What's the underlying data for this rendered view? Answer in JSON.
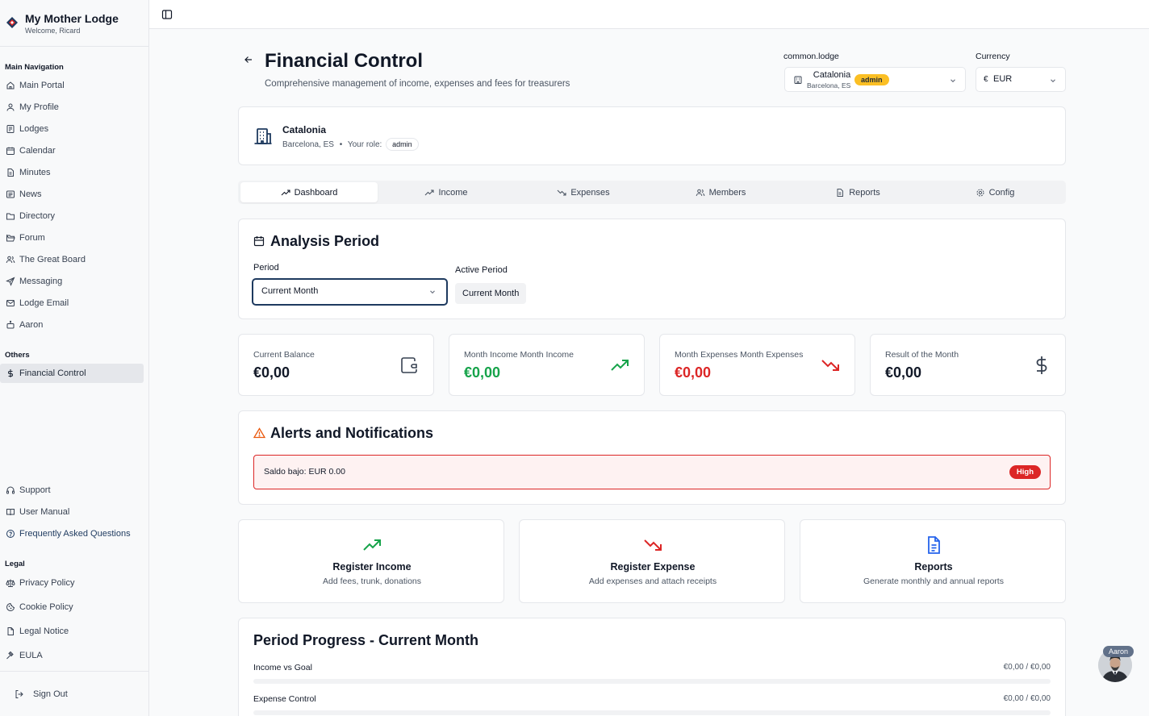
{
  "brand": {
    "title": "My Mother Lodge",
    "welcome": "Welcome, Ricard"
  },
  "sidebar": {
    "main_label": "Main Navigation",
    "main_items": [
      {
        "label": "Main Portal",
        "icon": "home-icon"
      },
      {
        "label": "My Profile",
        "icon": "user-icon"
      },
      {
        "label": "Lodges",
        "icon": "document-icon"
      },
      {
        "label": "Calendar",
        "icon": "calendar-icon"
      },
      {
        "label": "Minutes",
        "icon": "file-text-icon"
      },
      {
        "label": "News",
        "icon": "newspaper-icon"
      },
      {
        "label": "Directory",
        "icon": "folder-icon"
      },
      {
        "label": "Forum",
        "icon": "folder-open-icon"
      },
      {
        "label": "The Great Board",
        "icon": "users-icon"
      },
      {
        "label": "Messaging",
        "icon": "send-icon"
      },
      {
        "label": "Lodge Email",
        "icon": "mail-icon"
      },
      {
        "label": "Aaron",
        "icon": "bot-icon"
      }
    ],
    "others_label": "Others",
    "others_items": [
      {
        "label": "Financial Control",
        "icon": "dollar-icon",
        "active": true
      }
    ],
    "support_items": [
      {
        "label": "Support",
        "icon": "headphones-icon"
      },
      {
        "label": "User Manual",
        "icon": "book-icon"
      },
      {
        "label": "Frequently Asked Questions",
        "icon": "help-circle-icon"
      }
    ],
    "legal_label": "Legal",
    "legal_items": [
      {
        "label": "Privacy Policy",
        "icon": "scale-icon"
      },
      {
        "label": "Cookie Policy",
        "icon": "cookie-icon"
      },
      {
        "label": "Legal Notice",
        "icon": "file-icon"
      },
      {
        "label": "EULA",
        "icon": "gavel-icon"
      }
    ],
    "sign_out": "Sign Out"
  },
  "header": {
    "title": "Financial Control",
    "subtitle": "Comprehensive management of income, expenses and fees for treasurers",
    "lodge_label": "common.lodge",
    "lodge_name": "Catalonia",
    "lodge_location": "Barcelona, ES",
    "lodge_role": "admin",
    "currency_label": "Currency",
    "currency_symbol": "€",
    "currency_value": "EUR"
  },
  "lodge_card": {
    "name": "Catalonia",
    "location": "Barcelona, ES",
    "bullet": "•",
    "role_label": "Your role:",
    "role": "admin"
  },
  "tabs": [
    "Dashboard",
    "Income",
    "Expenses",
    "Members",
    "Reports",
    "Config"
  ],
  "period": {
    "title": "Analysis Period",
    "period_label": "Period",
    "period_value": "Current Month",
    "active_label": "Active Period",
    "active_value": "Current Month"
  },
  "stats": [
    {
      "label": "Current Balance",
      "value": "€0,00",
      "color": "#111827",
      "icon": "wallet-icon"
    },
    {
      "label": "Month Income Month Income",
      "value": "€0,00",
      "color": "#16a34a",
      "icon": "trending-up-icon"
    },
    {
      "label": "Month Expenses Month Expenses",
      "value": "€0,00",
      "color": "#dc2626",
      "icon": "trending-down-icon"
    },
    {
      "label": "Result of the Month",
      "value": "€0,00",
      "color": "#111827",
      "icon": "dollar-icon"
    }
  ],
  "alerts": {
    "title": "Alerts and Notifications",
    "items": [
      {
        "text": "Saldo bajo: EUR 0.00",
        "level": "High"
      }
    ]
  },
  "actions": [
    {
      "title": "Register Income",
      "desc": "Add fees, trunk, donations",
      "icon": "trending-up-icon"
    },
    {
      "title": "Register Expense",
      "desc": "Add expenses and attach receipts",
      "icon": "trending-down-icon"
    },
    {
      "title": "Reports",
      "desc": "Generate monthly and annual reports",
      "icon": "file-text-icon"
    }
  ],
  "progress": {
    "title": "Period Progress - Current Month",
    "rows": [
      {
        "label": "Income vs Goal",
        "value": "€0,00 / €0,00",
        "fraction": 0
      },
      {
        "label": "Expense Control",
        "value": "€0,00 / €0,00",
        "fraction": 0
      }
    ]
  },
  "assistant": {
    "name": "Aaron"
  },
  "colors": {
    "accent": "#1e3a5f",
    "income": "#16a34a",
    "expense": "#dc2626",
    "warning": "#ea580c",
    "badge": "#fbbf24"
  }
}
